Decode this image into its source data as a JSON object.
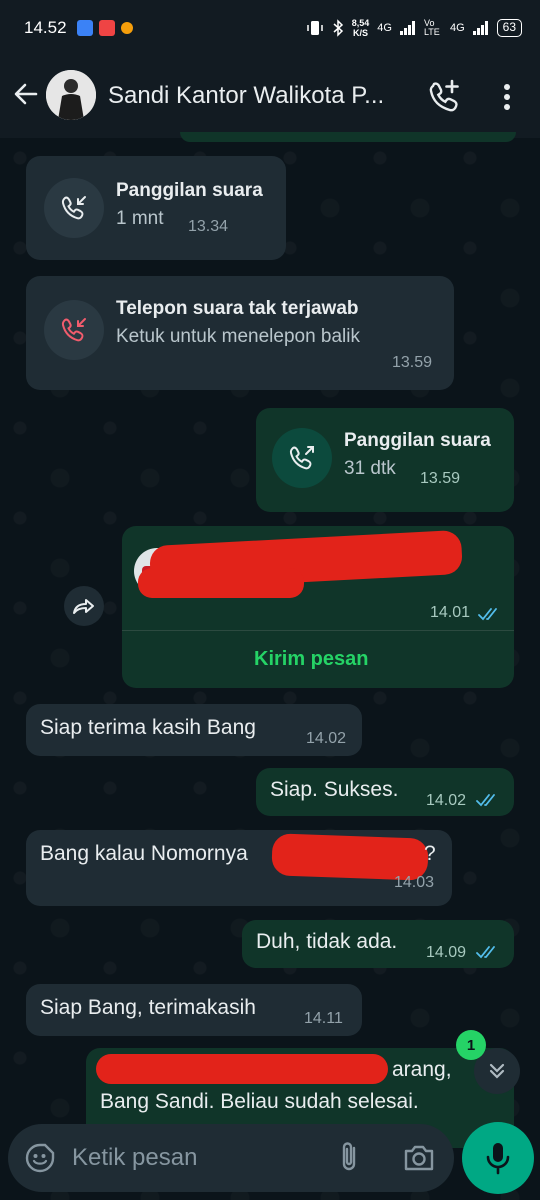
{
  "status_bar": {
    "time": "14.52",
    "speed_value": "8,54",
    "speed_unit": "K/S",
    "network1": "4G",
    "volte": "Vo LTE",
    "network2": "4G",
    "battery": "63"
  },
  "header": {
    "contact_name": "Sandi Kantor Walikota P..."
  },
  "messages": {
    "call1": {
      "title": "Panggilan suara",
      "sub": "1 mnt",
      "time": "13.34"
    },
    "call2": {
      "title": "Telepon suara tak terjawab",
      "sub": "Ketuk untuk menelepon balik",
      "time": "13.59"
    },
    "call3": {
      "title": "Panggilan suara",
      "sub": "31 dtk",
      "time": "13.59"
    },
    "contact_card": {
      "time": "14.01",
      "action": "Kirim pesan"
    },
    "m1": {
      "text": "Siap terima kasih Bang",
      "time": "14.02"
    },
    "m2": {
      "text": "Siap. Sukses.",
      "time": "14.02"
    },
    "m3": {
      "text_a": "Bang kalau Nomornya",
      "text_b": "?",
      "time": "14.03"
    },
    "m4": {
      "text": "Duh, tidak ada.",
      "time": "14.09"
    },
    "m5": {
      "text": "Siap Bang, terimakasih",
      "time": "14.11"
    },
    "m6": {
      "text_a": "arang,",
      "text_b": "Bang Sandi. Beliau sudah selesai."
    }
  },
  "unread_badge": "1",
  "input": {
    "placeholder": "Ketik pesan"
  },
  "colors": {
    "background": "#0b141a",
    "incoming": "#1f2c34",
    "outgoing": "#005c4b",
    "accent": "#00a884",
    "missed": "#f15c6d",
    "read_ticks": "#53bdeb"
  }
}
